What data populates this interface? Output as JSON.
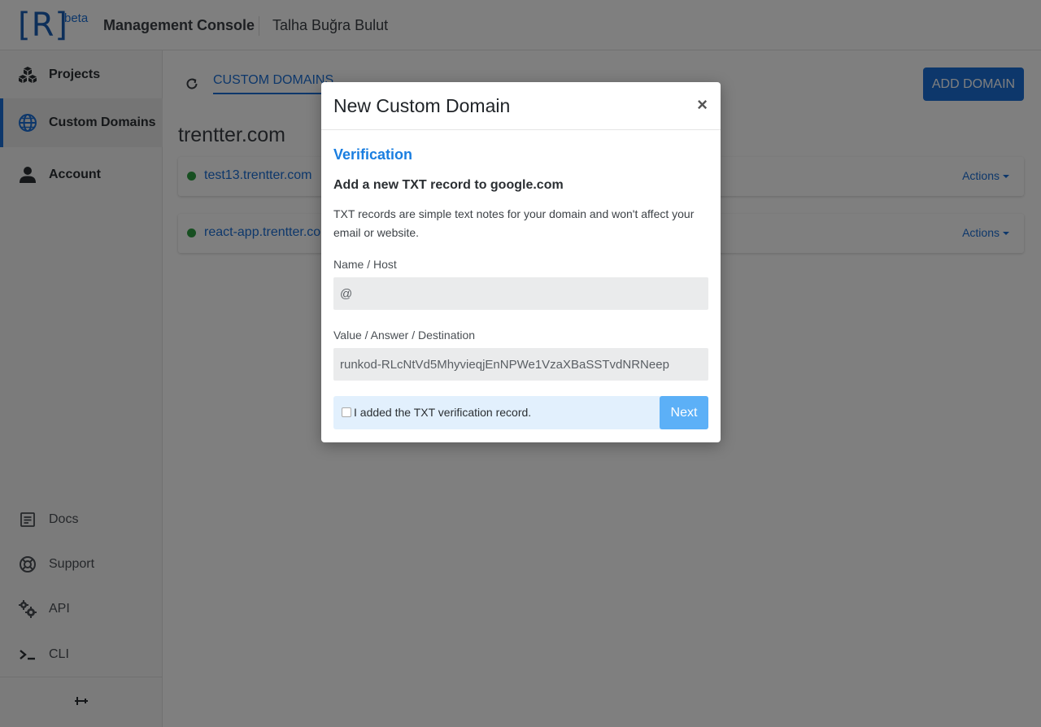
{
  "header": {
    "logo": "[R]",
    "logo_badge": "beta",
    "title": "Management Console",
    "user": "Talha Buğra Bulut"
  },
  "sidebar": {
    "items": [
      {
        "label": "Projects",
        "icon": "cubes-icon"
      },
      {
        "label": "Custom Domains",
        "icon": "globe-icon",
        "active": true
      },
      {
        "label": "Account",
        "icon": "user-icon"
      }
    ],
    "footer": [
      {
        "label": "Docs",
        "icon": "document-icon"
      },
      {
        "label": "Support",
        "icon": "lifebuoy-icon"
      },
      {
        "label": "API",
        "icon": "gears-icon"
      },
      {
        "label": "CLI",
        "icon": "terminal-icon"
      }
    ]
  },
  "main": {
    "tab": "CUSTOM DOMAINS",
    "add_button": "ADD DOMAIN",
    "group_title": "trentter.com",
    "domains": [
      {
        "name": "test13.trentter.com",
        "actions": "Actions",
        "status_color": "#2e9e43"
      },
      {
        "name": "react-app.trentter.co",
        "actions": "Actions",
        "status_color": "#2e9e43"
      }
    ]
  },
  "modal": {
    "title": "New Custom Domain",
    "close": "×",
    "section": "Verification",
    "subtitle": "Add a new TXT record to google.com",
    "description": "TXT records are simple text notes for your domain and won't affect your email or website.",
    "name_label": "Name / Host",
    "name_value": "@",
    "value_label": "Value / Answer / Destination",
    "value_value": "runkod-RLcNtVd5MhyvieqjEnNPWe1VzaXBaSSTvdNRNeep",
    "checkbox_label": "I added the TXT verification record.",
    "checkbox_checked": false,
    "next_button": "Next"
  },
  "colors": {
    "accent": "#1a6fd6",
    "status_ok": "#2e9e43",
    "overlay": "rgba(0,0,0,0.5)"
  }
}
